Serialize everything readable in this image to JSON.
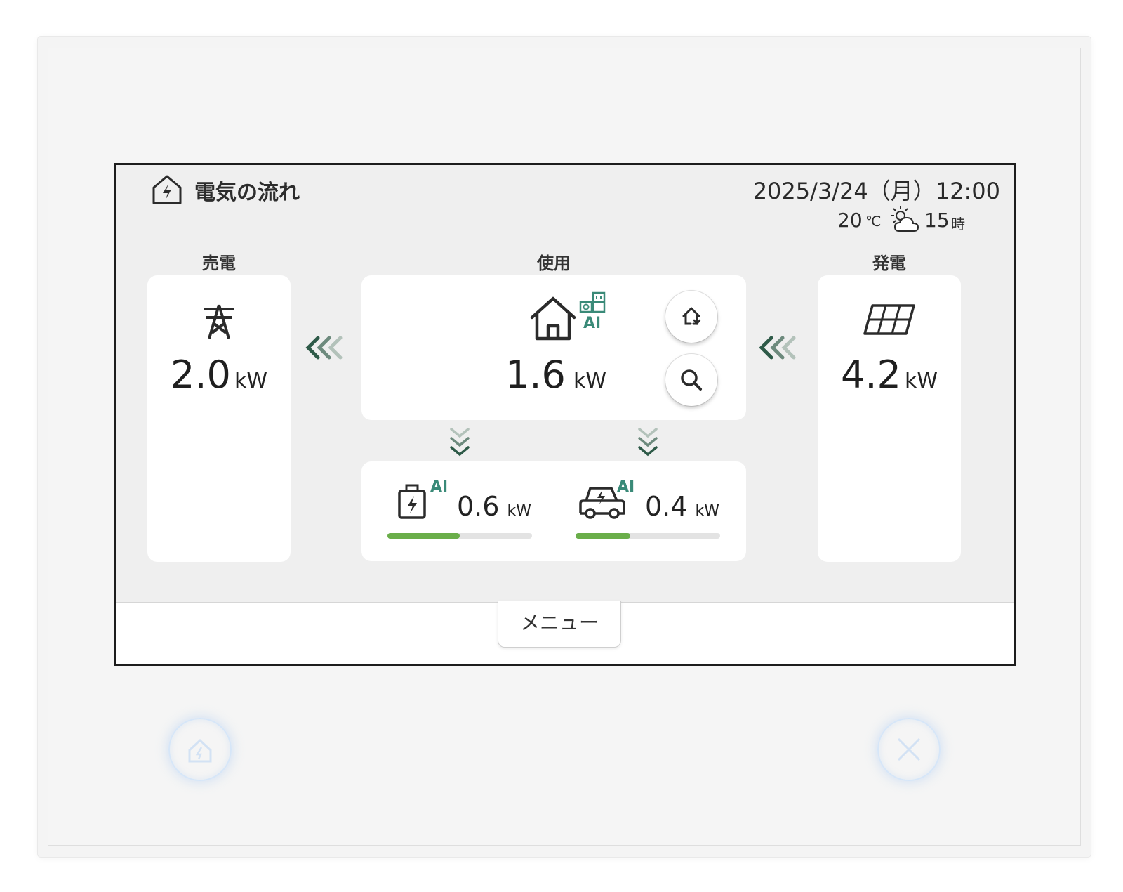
{
  "header": {
    "title": "電気の流れ",
    "datetime": "2025/3/24（月）12:00",
    "temperature": "20",
    "temperature_unit": "℃",
    "forecast_hour": "15",
    "forecast_hour_unit": "時"
  },
  "sell": {
    "label": "売電",
    "value": "2.0",
    "unit": "kW"
  },
  "usage": {
    "label": "使用",
    "value": "1.6",
    "unit": "kW",
    "ai_badge": "AI"
  },
  "generation": {
    "label": "発電",
    "value": "4.2",
    "unit": "kW"
  },
  "battery": {
    "ai_badge": "AI",
    "value": "0.6",
    "unit": "kW",
    "level": 0.5
  },
  "ev": {
    "ai_badge": "AI",
    "value": "0.4",
    "unit": "kW",
    "level": 0.38
  },
  "menu": {
    "label": "メニュー"
  },
  "colors": {
    "arrow_dark": "#2e5a48",
    "arrow_light": "#a9b9b1",
    "ai": "#3a8a78",
    "bar": "#6aae4a"
  }
}
